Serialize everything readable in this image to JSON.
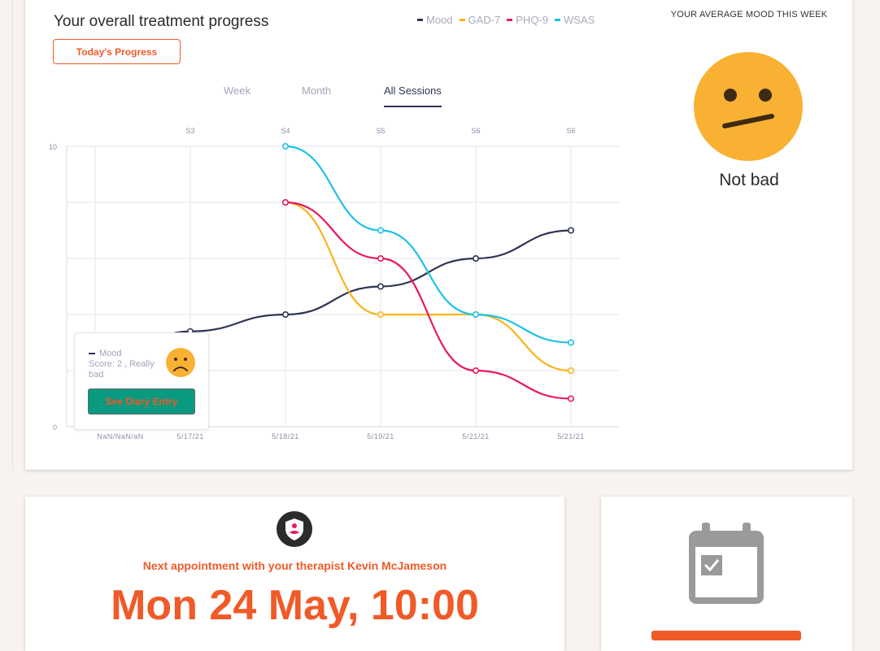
{
  "progress": {
    "title": "Your overall treatment progress",
    "today_button": "Today's Progress",
    "legend": [
      {
        "label": "Mood",
        "color": "#2f3452"
      },
      {
        "label": "GAD-7",
        "color": "#f7b519"
      },
      {
        "label": "PHQ-9",
        "color": "#e8185f"
      },
      {
        "label": "WSAS",
        "color": "#1cc2e8"
      }
    ],
    "tabs": [
      {
        "label": "Week",
        "active": false
      },
      {
        "label": "Month",
        "active": false
      },
      {
        "label": "All Sessions",
        "active": true
      }
    ]
  },
  "chart_data": {
    "type": "line",
    "title": "",
    "y_tick_labels": [
      "10",
      "0"
    ],
    "ylim": [
      0,
      10
    ],
    "grid": true,
    "top_labels": [
      "S3",
      "S4",
      "S5",
      "S6",
      "S6"
    ],
    "x": [
      "NaN/NaN/aN",
      "5/17/21",
      "5/18/21",
      "5/19/21",
      "5/21/21",
      "5/21/21"
    ],
    "series": [
      {
        "name": "Mood",
        "color": "#2f3452",
        "values": [
          2,
          3.4,
          4,
          5,
          6,
          7
        ]
      },
      {
        "name": "GAD-7",
        "color": "#f7b519",
        "values": [
          null,
          null,
          8,
          4,
          4,
          2
        ]
      },
      {
        "name": "PHQ-9",
        "color": "#e8185f",
        "values": [
          null,
          null,
          8,
          6,
          2,
          1
        ]
      },
      {
        "name": "WSAS",
        "color": "#1cc2e8",
        "values": [
          null,
          null,
          10,
          7,
          4,
          3
        ]
      }
    ]
  },
  "tooltip": {
    "series": "Mood",
    "score": "Score: 2 , Really bad",
    "button": "See Diary Entry",
    "face_icon": "sad-face-icon"
  },
  "mood": {
    "title": "YOUR AVERAGE MOOD THIS WEEK",
    "label": "Not bad",
    "face_icon": "neutral-face-icon",
    "face_color": "#f8b133"
  },
  "appointment": {
    "icon": "shield-icon",
    "next_text": "Next appointment with your therapist Kevin McJameson",
    "date": "Mon 24 May, 10:00"
  },
  "calendar": {
    "icon": "calendar-check-icon"
  }
}
